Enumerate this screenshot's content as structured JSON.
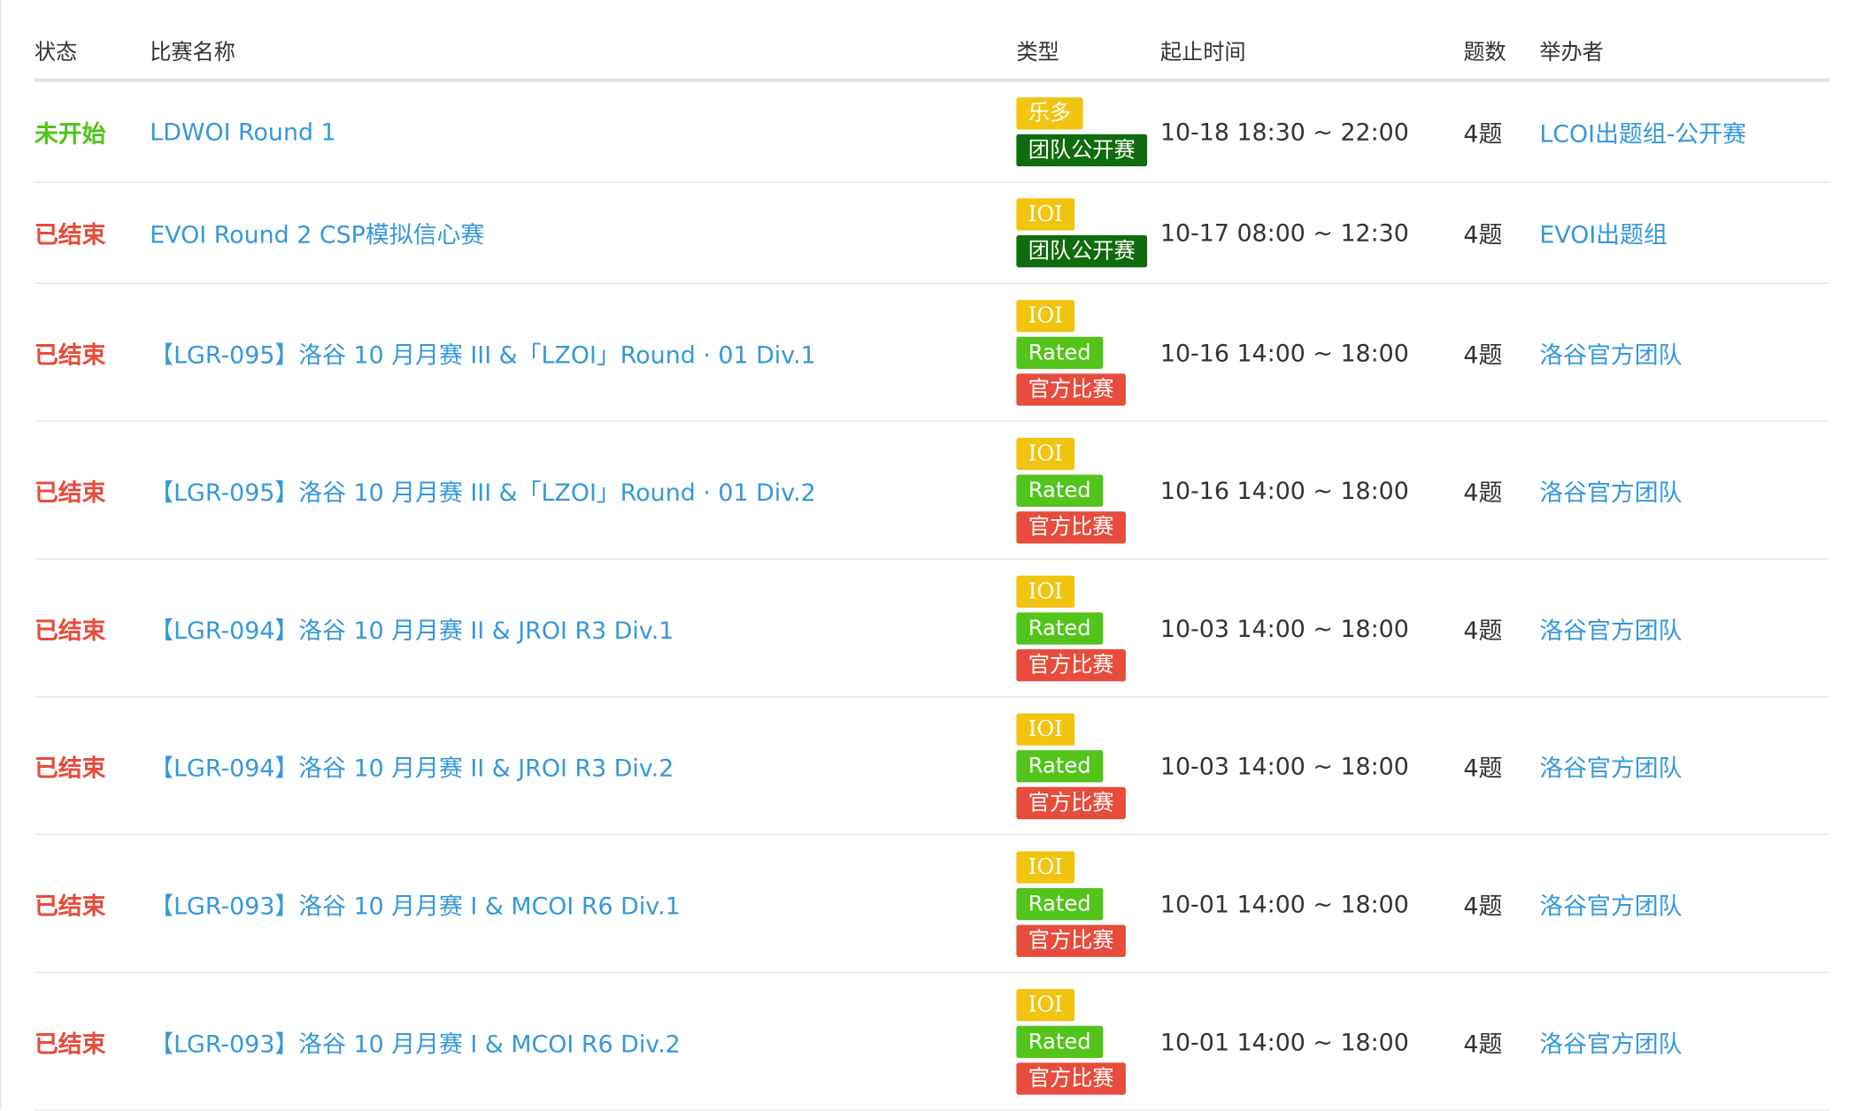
{
  "colors": {
    "status_upcoming": "#52c41a",
    "status_ended": "#e74c3c",
    "link": "#3498db",
    "tag_ledo": "#f1c40f",
    "tag_ioi": "#f1c40f",
    "tag_team": "#0e6b0e",
    "tag_rated": "#52c41a",
    "tag_official": "#e74c3c"
  },
  "header": {
    "status": "状态",
    "name": "比赛名称",
    "type": "类型",
    "time": "起止时间",
    "count": "题数",
    "organizer": "举办者"
  },
  "contests": [
    {
      "status": "未开始",
      "status_kind": "upcoming",
      "name": "LDWOI Round 1",
      "tags": [
        {
          "label": "乐多",
          "kind": "ledo"
        },
        {
          "label": "团队公开赛",
          "kind": "team"
        }
      ],
      "time": "10-18 18:30 ~ 22:00",
      "count": "4题",
      "organizer": "LCOI出题组-公开赛"
    },
    {
      "status": "已结束",
      "status_kind": "ended",
      "name": "EVOI Round 2 CSP模拟信心赛",
      "tags": [
        {
          "label": "IOI",
          "kind": "ioi"
        },
        {
          "label": "团队公开赛",
          "kind": "team"
        }
      ],
      "time": "10-17 08:00 ~ 12:30",
      "count": "4题",
      "organizer": "EVOI出题组"
    },
    {
      "status": "已结束",
      "status_kind": "ended",
      "name": "【LGR-095】洛谷 10 月月赛 III &「LZOI」Round · 01 Div.1",
      "tags": [
        {
          "label": "IOI",
          "kind": "ioi"
        },
        {
          "label": "Rated",
          "kind": "rated"
        },
        {
          "label": "官方比赛",
          "kind": "official"
        }
      ],
      "time": "10-16 14:00 ~ 18:00",
      "count": "4题",
      "organizer": "洛谷官方团队"
    },
    {
      "status": "已结束",
      "status_kind": "ended",
      "name": "【LGR-095】洛谷 10 月月赛 III &「LZOI」Round · 01 Div.2",
      "tags": [
        {
          "label": "IOI",
          "kind": "ioi"
        },
        {
          "label": "Rated",
          "kind": "rated"
        },
        {
          "label": "官方比赛",
          "kind": "official"
        }
      ],
      "time": "10-16 14:00 ~ 18:00",
      "count": "4题",
      "organizer": "洛谷官方团队"
    },
    {
      "status": "已结束",
      "status_kind": "ended",
      "name": "【LGR-094】洛谷 10 月月赛 II & JROI R3 Div.1",
      "tags": [
        {
          "label": "IOI",
          "kind": "ioi"
        },
        {
          "label": "Rated",
          "kind": "rated"
        },
        {
          "label": "官方比赛",
          "kind": "official"
        }
      ],
      "time": "10-03 14:00 ~ 18:00",
      "count": "4题",
      "organizer": "洛谷官方团队"
    },
    {
      "status": "已结束",
      "status_kind": "ended",
      "name": "【LGR-094】洛谷 10 月月赛 II & JROI R3 Div.2",
      "tags": [
        {
          "label": "IOI",
          "kind": "ioi"
        },
        {
          "label": "Rated",
          "kind": "rated"
        },
        {
          "label": "官方比赛",
          "kind": "official"
        }
      ],
      "time": "10-03 14:00 ~ 18:00",
      "count": "4题",
      "organizer": "洛谷官方团队"
    },
    {
      "status": "已结束",
      "status_kind": "ended",
      "name": "【LGR-093】洛谷 10 月月赛 I & MCOI R6 Div.1",
      "tags": [
        {
          "label": "IOI",
          "kind": "ioi"
        },
        {
          "label": "Rated",
          "kind": "rated"
        },
        {
          "label": "官方比赛",
          "kind": "official"
        }
      ],
      "time": "10-01 14:00 ~ 18:00",
      "count": "4题",
      "organizer": "洛谷官方团队"
    },
    {
      "status": "已结束",
      "status_kind": "ended",
      "name": "【LGR-093】洛谷 10 月月赛 I & MCOI R6 Div.2",
      "tags": [
        {
          "label": "IOI",
          "kind": "ioi"
        },
        {
          "label": "Rated",
          "kind": "rated"
        },
        {
          "label": "官方比赛",
          "kind": "official"
        }
      ],
      "time": "10-01 14:00 ~ 18:00",
      "count": "4题",
      "organizer": "洛谷官方团队"
    }
  ]
}
